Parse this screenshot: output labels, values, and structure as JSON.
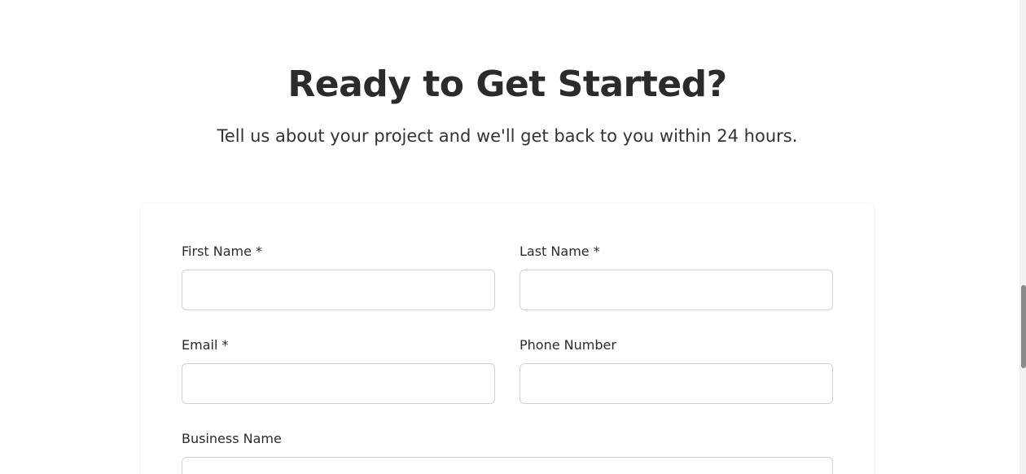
{
  "hero": {
    "title": "Ready to Get Started?",
    "subtitle": "Tell us about your project and we'll get back to you within 24 hours."
  },
  "form": {
    "first_name_label": "First Name *",
    "last_name_label": "Last Name *",
    "email_label": "Email *",
    "phone_label": "Phone Number",
    "business_label": "Business Name",
    "first_name_value": "",
    "last_name_value": "",
    "email_value": "",
    "phone_value": "",
    "business_value": ""
  }
}
